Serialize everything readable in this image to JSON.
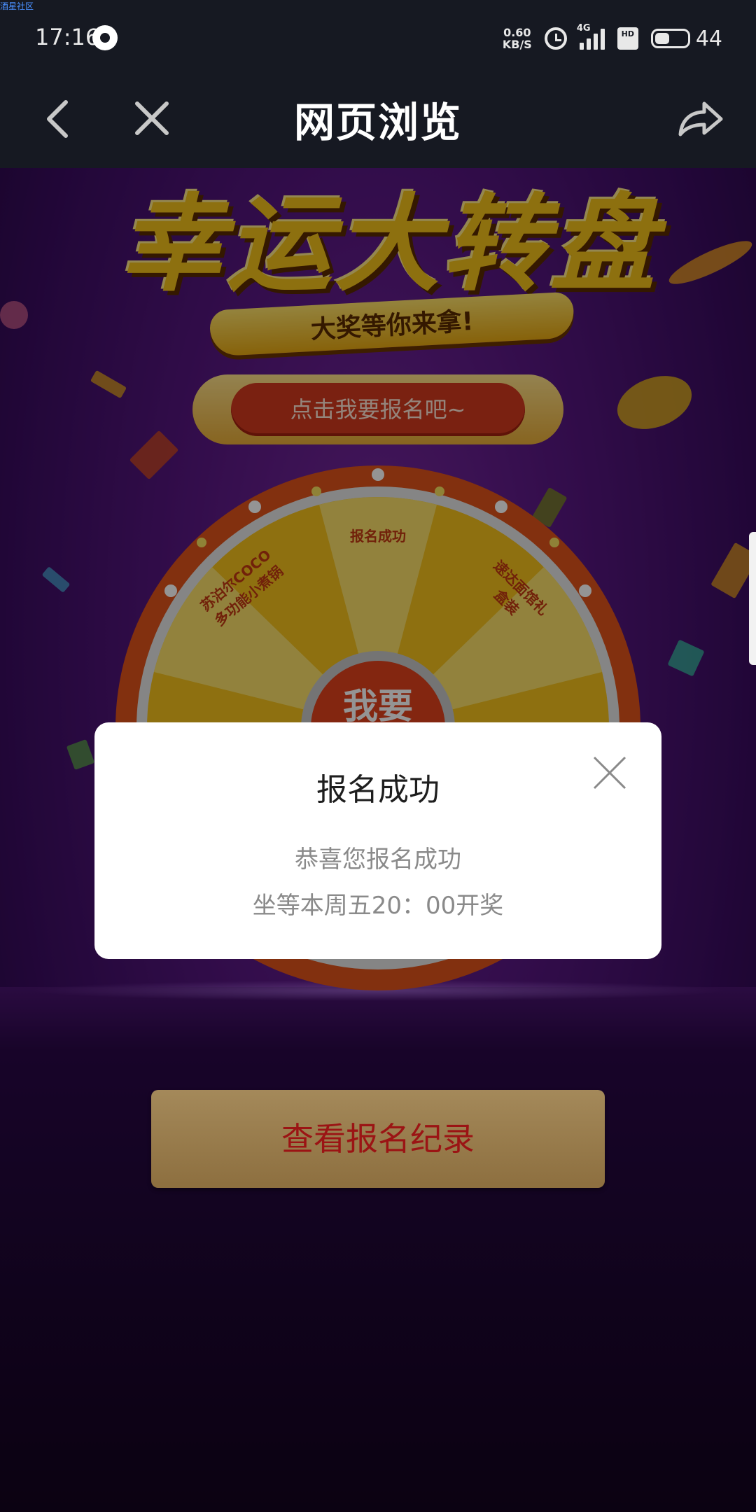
{
  "watermark": "酒星社区",
  "status_bar": {
    "time": "17:16",
    "net_speed_value": "0.60",
    "net_speed_unit": "KB/S",
    "network_type": "4G",
    "hd_badge": "HD",
    "battery_level": "44"
  },
  "nav": {
    "title": "网页浏览",
    "back_icon": "chevron-left-icon",
    "close_icon": "close-icon",
    "share_icon": "share-icon"
  },
  "promo": {
    "headline": "幸运大转盘",
    "ribbon": "大奖等你来拿!",
    "signup_button": "点击我要报名吧~",
    "wheel": {
      "segments": [
        "报名成功",
        "速达面馆礼盒装",
        "苏泊尔COCO多功能小煮锅"
      ],
      "hub_label": "我要"
    },
    "view_records_button": "查看报名纪录"
  },
  "dialog": {
    "title": "报名成功",
    "message_line1": "恭喜您报名成功",
    "message_line2": "坐等本周五20：00开奖"
  },
  "colors": {
    "status_bg": "#161922",
    "page_purple": "#5a1884",
    "accent_gold": "#f3c21a",
    "button_red": "#d33a1e",
    "dialog_bg": "#ffffff"
  }
}
